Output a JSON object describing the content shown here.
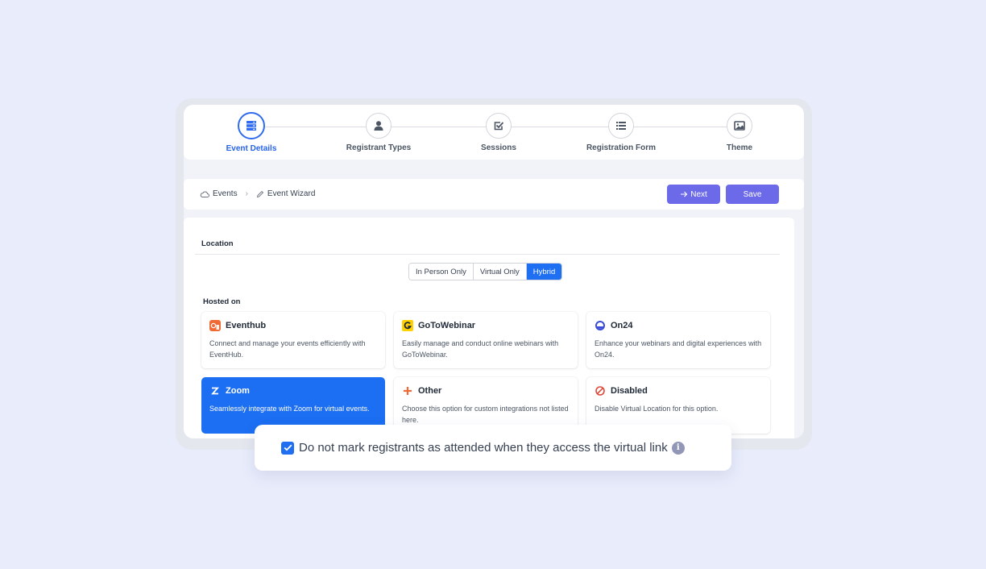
{
  "stepper": {
    "steps": [
      {
        "label": "Event Details",
        "icon": "server-icon",
        "active": true
      },
      {
        "label": "Registrant Types",
        "icon": "user-icon",
        "active": false
      },
      {
        "label": "Sessions",
        "icon": "check-square-icon",
        "active": false
      },
      {
        "label": "Registration Form",
        "icon": "list-icon",
        "active": false
      },
      {
        "label": "Theme",
        "icon": "image-icon",
        "active": false
      }
    ]
  },
  "breadcrumb": {
    "root": "Events",
    "current": "Event Wizard"
  },
  "toolbar": {
    "next_label": "Next",
    "save_label": "Save"
  },
  "location": {
    "title": "Location",
    "options": [
      "In Person Only",
      "Virtual Only",
      "Hybrid"
    ],
    "selected": "Hybrid"
  },
  "hosted": {
    "title": "Hosted on",
    "providers": [
      {
        "name": "Eventhub",
        "desc": "Connect and manage your events efficiently with EventHub."
      },
      {
        "name": "GoToWebinar",
        "desc": "Easily manage and conduct online webinars with GoToWebinar."
      },
      {
        "name": "On24",
        "desc": "Enhance your webinars and digital experiences with On24."
      },
      {
        "name": "Zoom",
        "desc": "Seamlessly integrate with Zoom for virtual events."
      },
      {
        "name": "Other",
        "desc": "Choose this option for custom integrations not listed here."
      },
      {
        "name": "Disabled",
        "desc": "Disable Virtual Location for this option."
      }
    ],
    "selected": "Zoom"
  },
  "attendance_option": {
    "label": "Do not mark registrants as attended when they access the virtual link",
    "checked": true,
    "info_glyph": "i"
  },
  "colors": {
    "accent": "#1e6ff1",
    "button": "#6c6ae8",
    "background": "#e8ecfb"
  }
}
